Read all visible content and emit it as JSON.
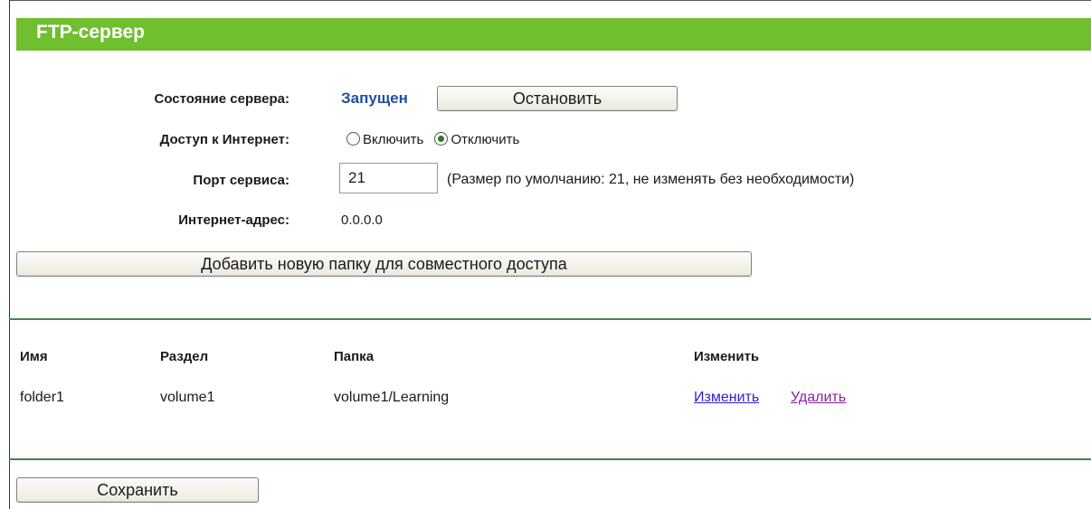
{
  "header": {
    "title": "FTP-сервер"
  },
  "server": {
    "status_label": "Состояние сервера:",
    "status_value": "Запущен",
    "stop_button": "Остановить",
    "internet_access_label": "Доступ к Интернет:",
    "radio_enable": "Включить",
    "radio_disable": "Отключить",
    "internet_access_selected": "Отключить",
    "port_label": "Порт сервиса:",
    "port_value": "21",
    "port_hint": "(Размер по умолчанию: 21, не изменять без необходимости)",
    "inet_address_label": "Интернет-адрес:",
    "inet_address_value": "0.0.0.0"
  },
  "add_folder_button": "Добавить новую папку для совместного доступа",
  "table": {
    "columns": [
      "Имя",
      "Раздел",
      "Папка",
      "Изменить"
    ],
    "rows": [
      {
        "name": "folder1",
        "partition": "volume1",
        "folder": "volume1/Learning",
        "edit": "Изменить",
        "delete": "Удалить"
      }
    ]
  },
  "save_button": "Сохранить",
  "colors": {
    "header_bg": "#6fbf2f",
    "status_running": "#1f4fa3",
    "divider": "#3c8a4f",
    "link_edit": "#2a1fd6",
    "link_delete": "#8a1fa0"
  }
}
